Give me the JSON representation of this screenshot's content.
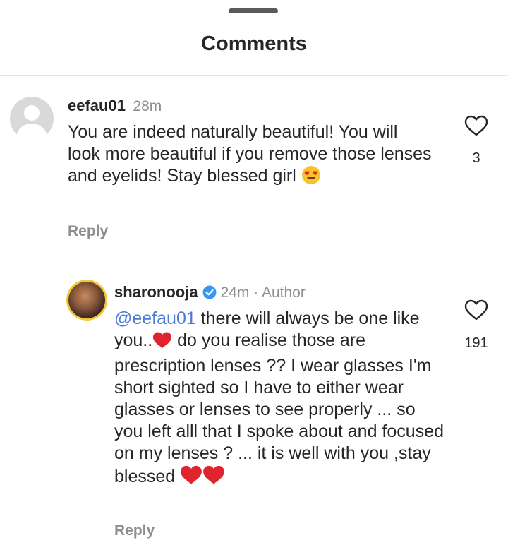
{
  "header": {
    "title": "Comments"
  },
  "comments": [
    {
      "username": "eefau01",
      "time": "28m",
      "text": "You are indeed naturally beautiful! You will look more beautiful if you remove those lenses and eyelids! Stay blessed girl",
      "emoji": "heart-eyes-emoji",
      "likes": "3",
      "reply_label": "Reply"
    }
  ],
  "replies": [
    {
      "username": "sharonooja",
      "verified": true,
      "time": "24m",
      "author_tag": "Author",
      "mention": "@eefau01",
      "text_part1": "there will always be one like you..",
      "text_part2": "do you realise those are prescription lenses ?? I wear glasses I'm short sighted so I have to either wear glasses or lenses to see properly ... so you left alll that I spoke about and focused on my lenses ? ... it is well with you ,stay blessed",
      "likes": "191",
      "reply_label": "Reply"
    }
  ],
  "colors": {
    "mention": "#4a7bd6",
    "heart": "#e0242f",
    "verified": "#3897f0",
    "muted": "#8e8e8e"
  }
}
